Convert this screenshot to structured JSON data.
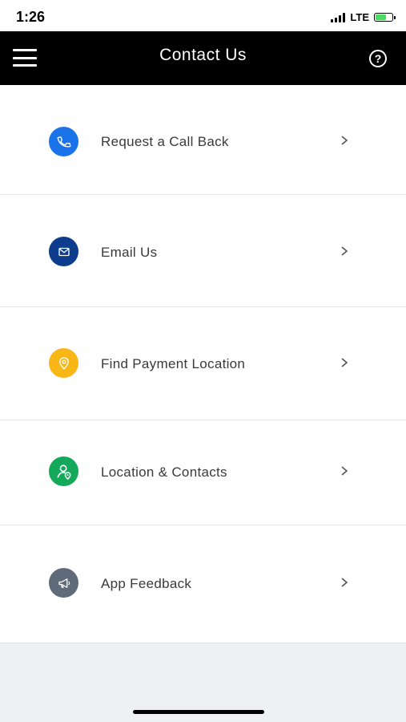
{
  "status": {
    "time": "1:26",
    "network": "LTE"
  },
  "header": {
    "title": "Contact Us"
  },
  "menu": {
    "items": [
      {
        "label": "Request a Call Back",
        "icon": "phone-icon",
        "color": "#1a73e8"
      },
      {
        "label": "Email Us",
        "icon": "mail-icon",
        "color": "#0d3c8c"
      },
      {
        "label": "Find Payment Location",
        "icon": "location-pin-icon",
        "color": "#f8b617"
      },
      {
        "label": "Location & Contacts",
        "icon": "contact-location-icon",
        "color": "#14a85a"
      },
      {
        "label": "App Feedback",
        "icon": "megaphone-icon",
        "color": "#5f6b78"
      }
    ]
  }
}
